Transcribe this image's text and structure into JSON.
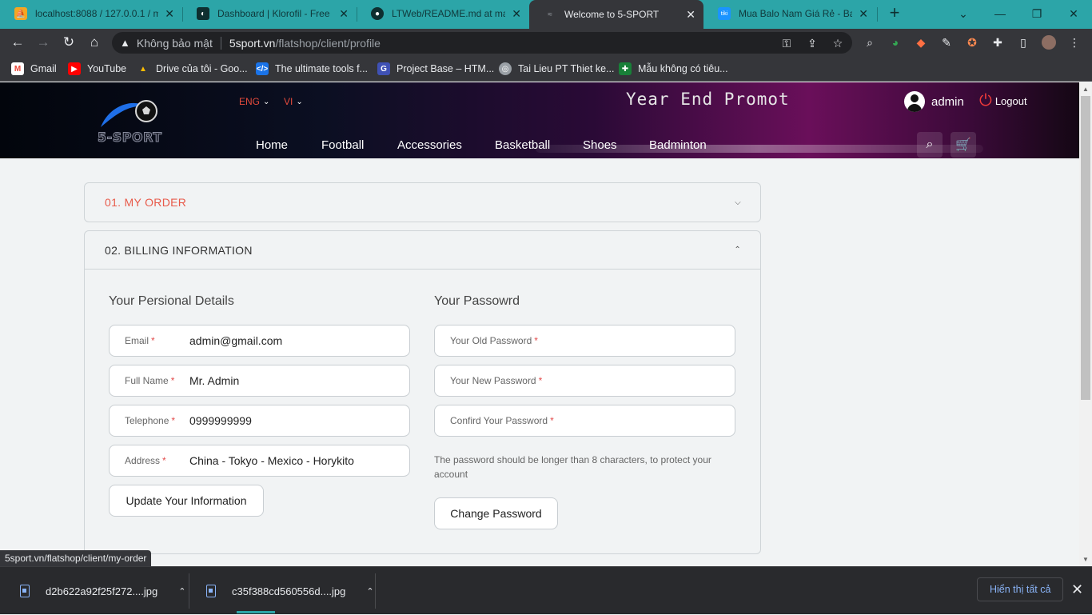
{
  "browser": {
    "tabs": [
      {
        "title": "localhost:8088 / 127.0.0.1 / m",
        "active": false
      },
      {
        "title": "Dashboard | Klorofil - Free Bo",
        "active": false
      },
      {
        "title": "LTWeb/README.md at maste",
        "active": false
      },
      {
        "title": "Welcome to 5-SPORT",
        "active": true
      },
      {
        "title": "Mua Balo Nam Giá Rẻ - Balo",
        "active": false
      }
    ],
    "new_tab": "+",
    "window_controls": {
      "minimize": "⌄",
      "restore": "—",
      "maximize": "❐",
      "close": "✕"
    },
    "address": {
      "security_label": "Không bảo mật",
      "host": "5sport.vn",
      "path": "/flatshop/client/profile"
    },
    "bookmarks": [
      {
        "label": "Gmail",
        "icon": "gmail-icon",
        "color": "#ea4335"
      },
      {
        "label": "YouTube",
        "icon": "youtube-icon",
        "color": "#ff0000"
      },
      {
        "label": "Drive của tôi - Goo...",
        "icon": "drive-icon",
        "color": "#fbbc04"
      },
      {
        "label": "The ultimate tools f...",
        "icon": "code-icon",
        "color": "#1a73e8"
      },
      {
        "label": "Project Base – HTM...",
        "icon": "g-icon",
        "color": "#3f51b5"
      },
      {
        "label": "Tai Lieu PT Thiet ke...",
        "icon": "globe-icon",
        "color": "#9aa0a6"
      },
      {
        "label": "Mẫu không có tiêu...",
        "icon": "sheets-icon",
        "color": "#188038"
      }
    ],
    "status_url": "5sport.vn/flatshop/client/my-order",
    "downloads": [
      {
        "filename": "d2b622a92f25f272....jpg"
      },
      {
        "filename": "c35f388cd560556d....jpg"
      }
    ],
    "show_all": "Hiển thị tất cả"
  },
  "site": {
    "logo_text": "5-SPORT",
    "languages": [
      {
        "label": "ENG"
      },
      {
        "label": "VI"
      }
    ],
    "promo": "Year End Promot",
    "user_name": "admin",
    "logout_label": "Logout",
    "nav": [
      "Home",
      "Football",
      "Accessories",
      "Basketball",
      "Shoes",
      "Badminton"
    ]
  },
  "profile": {
    "sections": [
      {
        "title": "01. MY ORDER",
        "expanded": false
      },
      {
        "title": "02. BILLING INFORMATION",
        "expanded": true
      }
    ],
    "personal": {
      "heading": "Your Persional Details",
      "fields": [
        {
          "label": "Email",
          "value": "admin@gmail.com"
        },
        {
          "label": "Full Name",
          "value": "Mr. Admin"
        },
        {
          "label": "Telephone",
          "value": "0999999999"
        },
        {
          "label": "Address",
          "value": "China - Tokyo - Mexico - Horykito"
        }
      ],
      "required_mark": "*",
      "submit_label": "Update Your Information"
    },
    "password": {
      "heading": "Your Passowrd",
      "fields": [
        {
          "label": "Your Old Password"
        },
        {
          "label": "Your New Password"
        },
        {
          "label": "Confird Your Password"
        }
      ],
      "required_mark": "*",
      "hint": "The password should be longer than 8 characters, to protect your account",
      "submit_label": "Change Password"
    }
  }
}
